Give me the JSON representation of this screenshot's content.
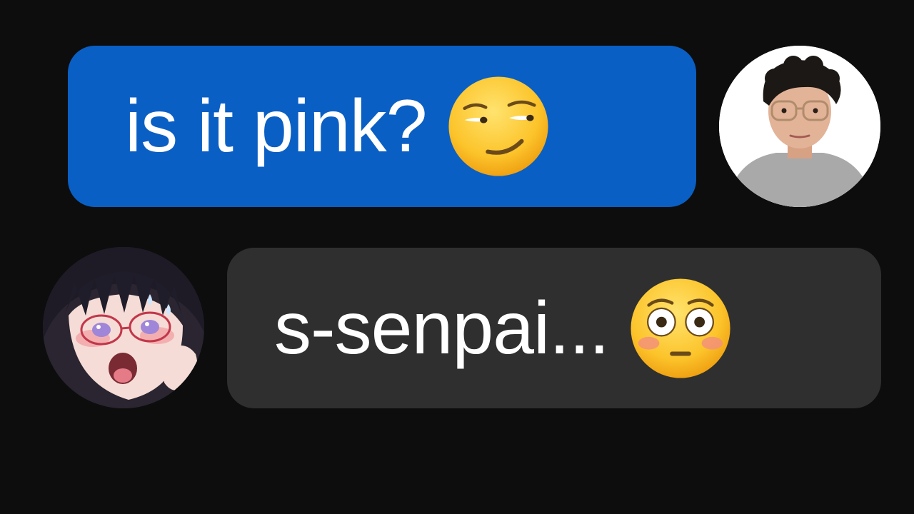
{
  "conversation": {
    "messages": [
      {
        "sender": "user",
        "text": "is it pink?",
        "emoji_icon": "smirking-face-icon",
        "bubble_color": "#0a5fc4",
        "avatar_icon": "young-man-glasses-avatar"
      },
      {
        "sender": "other",
        "text": "s-senpai...",
        "emoji_icon": "flushed-face-icon",
        "bubble_color": "#2f2f2f",
        "avatar_icon": "anime-girl-glasses-avatar"
      }
    ],
    "background_color": "#0d0d0d",
    "text_color": "#ffffff"
  }
}
